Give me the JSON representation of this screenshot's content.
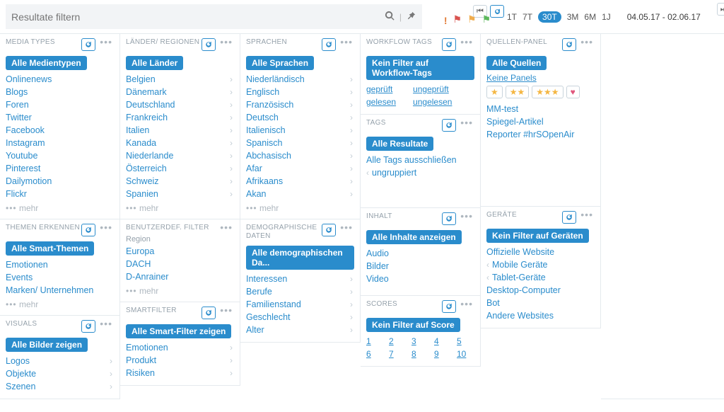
{
  "search": {
    "placeholder": "Resultate filtern"
  },
  "timeRange": {
    "items": [
      "1T",
      "7T",
      "30T",
      "3M",
      "6M",
      "1J"
    ],
    "active": "30T"
  },
  "dateRange": "04.05.17 - 02.06.17",
  "panels": {
    "mediaTypes": {
      "title": "MEDIA TYPES",
      "chip": "Alle Medientypen",
      "items": [
        "Onlinenews",
        "Blogs",
        "Foren",
        "Twitter",
        "Facebook",
        "Instagram",
        "Youtube",
        "Pinterest",
        "Dailymotion",
        "Flickr"
      ],
      "more": "mehr"
    },
    "countries": {
      "title": "LÄNDER/ REGIONEN",
      "chip": "Alle Länder",
      "items": [
        "Belgien",
        "Dänemark",
        "Deutschland",
        "Frankreich",
        "Italien",
        "Kanada",
        "Niederlande",
        "Österreich",
        "Schweiz",
        "Spanien"
      ],
      "more": "mehr",
      "chev": true
    },
    "languages": {
      "title": "SPRACHEN",
      "chip": "Alle Sprachen",
      "items": [
        "Niederländisch",
        "Englisch",
        "Französisch",
        "Deutsch",
        "Italienisch",
        "Spanisch",
        "Abchasisch",
        "Afar",
        "Afrikaans",
        "Akan"
      ],
      "more": "mehr",
      "chev": true
    },
    "workflow": {
      "title": "WORKFLOW TAGS",
      "chip": "Kein Filter auf Workflow-Tags",
      "cols": {
        "left": [
          "geprüft",
          "gelesen"
        ],
        "right": [
          "ungeprüft",
          "ungelesen"
        ]
      }
    },
    "quellen": {
      "title": "QUELLEN-PANEL",
      "chip": "Alle Quellen",
      "line1": "Keine Panels",
      "items": [
        "MM-test",
        "Spiegel-Artikel",
        "Reporter #hrSOpenAir"
      ]
    },
    "tags": {
      "title": "TAGS",
      "chip": "Alle Resultate",
      "items_chev": [
        {
          "t": "Alle Tags ausschließen",
          "c": null
        },
        {
          "t": "ungruppiert",
          "c": "l"
        }
      ]
    },
    "themen": {
      "title": "THEMEN ERKENNEN",
      "chip": "Alle Smart-Themen",
      "items": [
        "Emotionen",
        "Events",
        "Marken/ Unternehmen"
      ],
      "more": "mehr"
    },
    "benutzer": {
      "title": "BENUTZERDEF. FILTER",
      "sub": "Region",
      "items": [
        "Europa",
        "DACH",
        "D-Anrainer"
      ],
      "more": "mehr",
      "noRefresh": true
    },
    "demo": {
      "title": "DEMOGRAPHISCHE DATEN",
      "chip": "Alle demographischen Da...",
      "items": [
        "Interessen",
        "Berufe",
        "Familienstand",
        "Geschlecht",
        "Alter"
      ],
      "chev": true
    },
    "inhalt": {
      "title": "INHALT",
      "chip": "Alle Inhalte anzeigen",
      "items": [
        "Audio",
        "Bilder",
        "Video"
      ]
    },
    "geraete": {
      "title": "GERÄTE",
      "chip": "Kein Filter auf Geräten",
      "items_chev": [
        {
          "t": "Offizielle Website",
          "c": null
        },
        {
          "t": "Mobile Geräte",
          "c": "l"
        },
        {
          "t": "Tablet-Geräte",
          "c": "l"
        },
        {
          "t": "Desktop-Computer",
          "c": null
        },
        {
          "t": "Bot",
          "c": null
        },
        {
          "t": "Andere Websites",
          "c": null
        }
      ]
    },
    "visuals": {
      "title": "VISUALS",
      "chip": "Alle Bilder zeigen",
      "items": [
        "Logos",
        "Objekte",
        "Szenen"
      ],
      "chev": true
    },
    "smartfilter": {
      "title": "SMARTFILTER",
      "chip": "Alle Smart-Filter zeigen",
      "items": [
        "Emotionen",
        "Produkt",
        "Risiken"
      ],
      "chev": true
    },
    "scores": {
      "title": "SCORES",
      "chip": "Kein Filter auf Score",
      "nums": [
        "1",
        "2",
        "3",
        "4",
        "5",
        "6",
        "7",
        "8",
        "9",
        "10"
      ]
    }
  }
}
